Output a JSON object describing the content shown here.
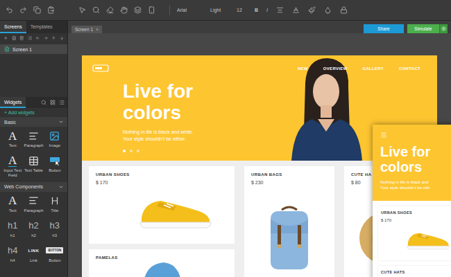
{
  "toolbar": {
    "font": "Arial",
    "weight": "Light",
    "size": "12",
    "bold": "B",
    "italic": "I"
  },
  "left_panel": {
    "tabs": [
      {
        "label": "Screens",
        "selected": true
      },
      {
        "label": "Templates",
        "selected": false
      }
    ],
    "screens": [
      {
        "label": "Screen 1",
        "selected": true
      }
    ],
    "widgets_tab": "Widgets",
    "add_widgets": "+ Add widgets",
    "groups": [
      {
        "title": "Basic",
        "expanded": true,
        "items": [
          {
            "label": "Text",
            "kind": "text",
            "glyph": "A"
          },
          {
            "label": "Paragraph",
            "kind": "paragraph"
          },
          {
            "label": "Image",
            "kind": "image"
          },
          {
            "label": "Input Text Field",
            "kind": "input",
            "glyph": "A"
          },
          {
            "label": "Text Table",
            "kind": "table"
          },
          {
            "label": "Button",
            "kind": "button"
          }
        ]
      },
      {
        "title": "Web Components",
        "expanded": true,
        "items": [
          {
            "label": "Text",
            "kind": "text",
            "glyph": "A"
          },
          {
            "label": "Paragraph",
            "kind": "paragraph"
          },
          {
            "label": "Title",
            "kind": "title"
          },
          {
            "label": "h1",
            "kind": "heading",
            "glyph": "h1"
          },
          {
            "label": "h2",
            "kind": "heading",
            "glyph": "h2"
          },
          {
            "label": "h3",
            "kind": "heading",
            "glyph": "h3"
          },
          {
            "label": "h4",
            "kind": "heading",
            "glyph": "h4"
          },
          {
            "label": "Link",
            "kind": "link",
            "glyph": "LINK"
          },
          {
            "label": "Button",
            "kind": "webbutton",
            "glyph": "BUTTON"
          }
        ]
      }
    ]
  },
  "canvas": {
    "tabs": [
      {
        "label": "Screen 1",
        "close": "×",
        "selected": true
      }
    ],
    "share": "Share",
    "simulate": "Simulate"
  },
  "design": {
    "nav": [
      "NEW",
      "OVERVIEW",
      "GALLERY",
      "CONTACT"
    ],
    "headline": [
      "Live for",
      "colors"
    ],
    "subtitle": [
      "Nothing in life is black and white.",
      "Your style shouldn't be either."
    ],
    "slides": [
      {
        "selected": true
      },
      {
        "selected": false
      },
      {
        "selected": false
      }
    ],
    "products": [
      {
        "name": "URBAN SHOES",
        "price": "$ 170",
        "kind": "shoe"
      },
      {
        "name": "URBAN BAGS",
        "price": "$ 230",
        "kind": "bag"
      },
      {
        "name": "CUTE HA",
        "price": "$ 80",
        "kind": "hat"
      },
      {
        "name": "PAMELAS",
        "kind": "cap"
      }
    ]
  },
  "mobile": {
    "headline": [
      "Live for",
      "colors"
    ],
    "subtitle": [
      "Nothing in life is black and",
      "Your style shouldn't be eith"
    ],
    "products": [
      {
        "name": "URBAN SHOES",
        "price": "$ 170",
        "kind": "shoe"
      },
      {
        "name": "CUTE HATS",
        "kind": "hat"
      }
    ]
  }
}
